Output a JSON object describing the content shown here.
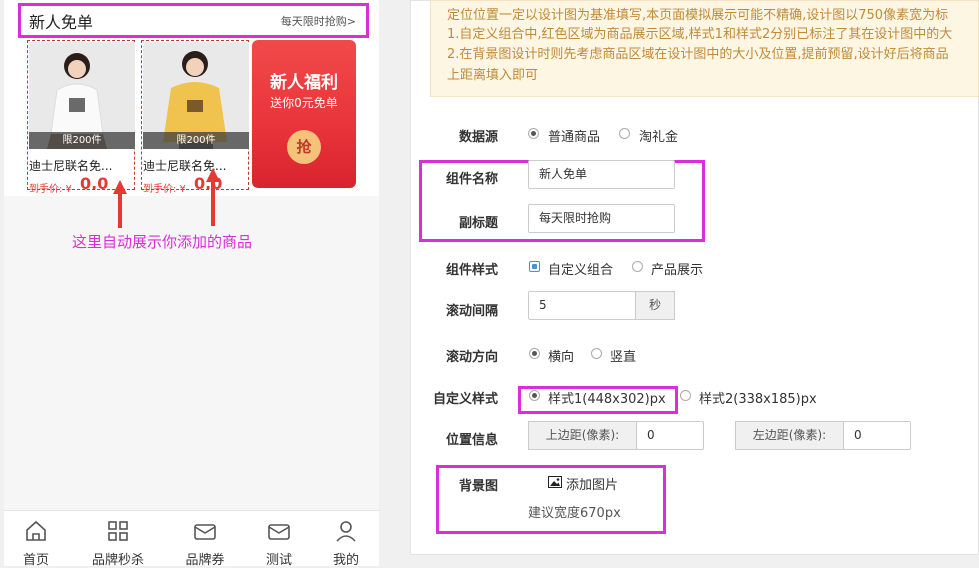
{
  "preview": {
    "header_title": "新人免单",
    "header_sub": "每天限时抢购>",
    "cards": [
      {
        "name": "迪士尼联名免...",
        "limit": "限200件",
        "price_label": "到手价: ¥",
        "price": "0.0"
      },
      {
        "name": "迪士尼联名免...",
        "limit": "限200件",
        "price_label": "到手价: ¥",
        "price": "0.0"
      }
    ],
    "promo_title": "新人福利",
    "promo_sub": "送你0元免单",
    "promo_button": "抢",
    "annotation": "这里自动展示你添加的商品"
  },
  "tabbar": [
    {
      "label": "首页",
      "icon": "home-icon"
    },
    {
      "label": "品牌秒杀",
      "icon": "grid-icon"
    },
    {
      "label": "品牌券",
      "icon": "coupon-icon"
    },
    {
      "label": "测试",
      "icon": "coupon-icon"
    },
    {
      "label": "我的",
      "icon": "user-icon"
    }
  ],
  "notice": {
    "line1": "定位位置一定以设计图为基准填写,本页面模拟展示可能不精确,设计图以750像素宽为标",
    "line2": "1.自定义组合中,红色区域为商品展示区域,样式1和样式2分别已标注了其在设计图中的大",
    "line3": "2.在背景图设计时则先考虑商品区域在设计图中的大小及位置,提前预留,设计好后将商品",
    "line4": "上距离填入即可"
  },
  "form": {
    "datasource_label": "数据源",
    "datasource_opt1": "普通商品",
    "datasource_opt2": "淘礼金",
    "name_label": "组件名称",
    "name_value": "新人免单",
    "subtitle_label": "副标题",
    "subtitle_value": "每天限时抢购",
    "style_label": "组件样式",
    "style_opt1": "自定义组合",
    "style_opt2": "产品展示",
    "interval_label": "滚动间隔",
    "interval_value": "5",
    "interval_unit": "秒",
    "direction_label": "滚动方向",
    "direction_opt1": "横向",
    "direction_opt2": "竖直",
    "custom_label": "自定义样式",
    "custom_opt1": "样式1(448x302)px",
    "custom_opt2": "样式2(338x185)px",
    "position_label": "位置信息",
    "top_label": "上边距(像素):",
    "top_value": "0",
    "left_label": "左边距(像素):",
    "left_value": "0",
    "bg_label": "背景图",
    "bg_button": "添加图片",
    "bg_hint": "建议宽度670px"
  },
  "colors": {
    "highlight": "#d82fd8",
    "price": "#e53935",
    "promo": "#e8333a"
  }
}
